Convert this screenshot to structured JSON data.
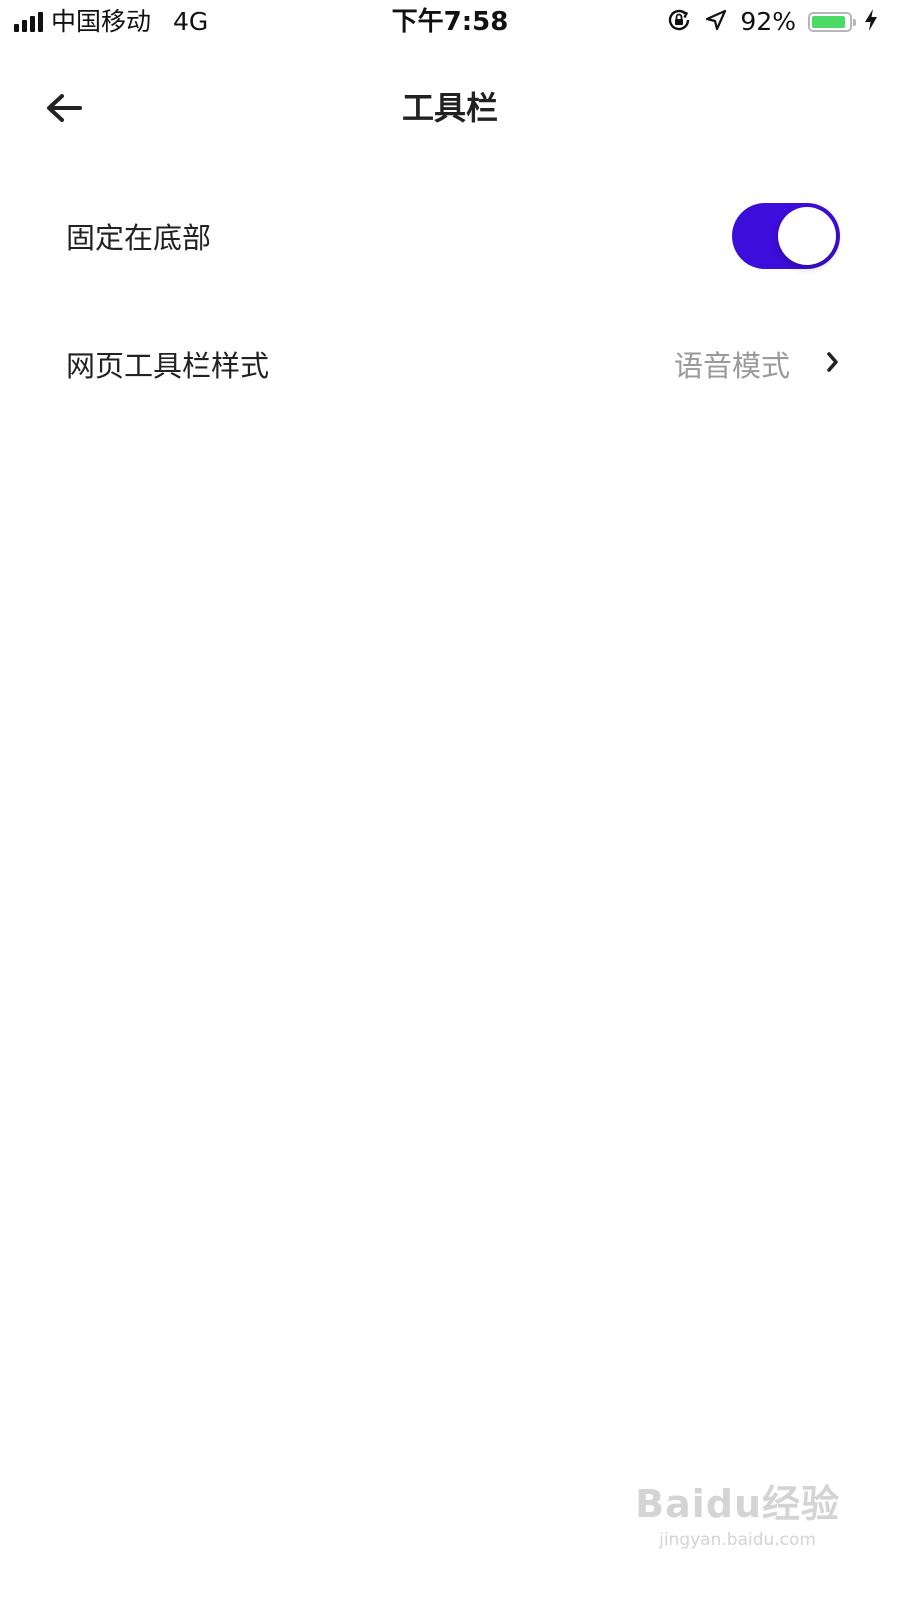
{
  "status_bar": {
    "carrier": "中国移动",
    "network": "4G",
    "time": "下午7:58",
    "battery_percent": "92%",
    "battery_level": 0.92,
    "battery_color": "#4cd964"
  },
  "nav": {
    "title": "工具栏",
    "back_icon": "arrow-left-icon"
  },
  "settings": [
    {
      "label": "固定在底部",
      "type": "toggle",
      "on": true,
      "accent": "#3d0ddc"
    },
    {
      "label": "网页工具栏样式",
      "type": "link",
      "value": "语音模式",
      "icon": "chevron-right-icon"
    }
  ],
  "watermark": {
    "main": "Baidu经验",
    "sub": "jingyan.baidu.com"
  }
}
